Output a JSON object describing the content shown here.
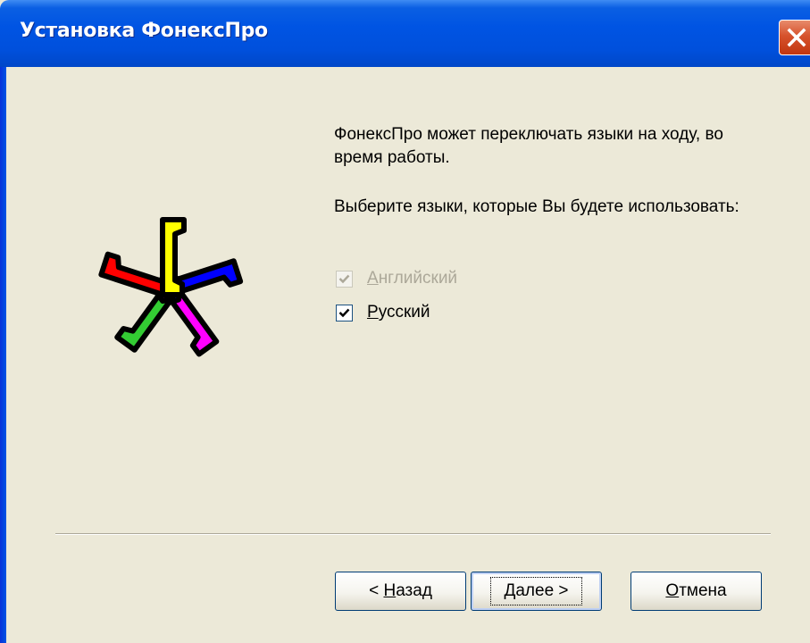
{
  "window": {
    "title": "Установка ФонексПро"
  },
  "content": {
    "paragraph1": "ФонексПро может переключать языки на ходу, во время работы.",
    "paragraph2": "Выберите языки, которые Вы будете использовать:"
  },
  "languages": [
    {
      "label_mnemonic": "А",
      "label_rest": "нглийский",
      "checked": true,
      "enabled": false
    },
    {
      "label_mnemonic": "Р",
      "label_rest": "усский",
      "checked": true,
      "enabled": true
    }
  ],
  "buttons": {
    "back": {
      "prefix": "< ",
      "mnemonic": "Н",
      "rest": "азад"
    },
    "next": {
      "mnemonic": "Д",
      "rest": "алее",
      "suffix": " >"
    },
    "cancel": {
      "mnemonic": "О",
      "rest": "тмена"
    }
  },
  "icons": {
    "app": "phones-star-logo-icon",
    "close": "close-icon",
    "check": "checkmark-icon"
  },
  "colors": {
    "titlebar": "#0054E3",
    "close_button": "#D6522C",
    "face": "#ECE9D8",
    "logo_red": "#FF0000",
    "logo_yellow": "#FFFF00",
    "logo_blue": "#0000FF",
    "logo_magenta": "#FF00FF",
    "logo_green": "#33CC33"
  }
}
